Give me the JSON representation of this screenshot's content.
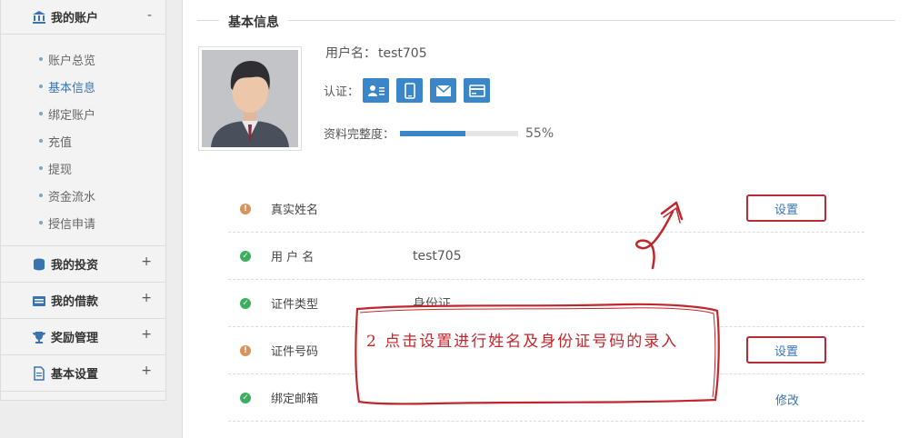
{
  "sidebar": {
    "sections": [
      {
        "label": "我的账户",
        "toggle": "-",
        "icon": "bank-icon"
      },
      {
        "label": "我的投资",
        "toggle": "+",
        "icon": "coins-icon"
      },
      {
        "label": "我的借款",
        "toggle": "+",
        "icon": "card-icon"
      },
      {
        "label": "奖励管理",
        "toggle": "+",
        "icon": "trophy-icon"
      },
      {
        "label": "基本设置",
        "toggle": "+",
        "icon": "document-icon"
      }
    ],
    "account_items": [
      "账户总览",
      "基本信息",
      "绑定账户",
      "充值",
      "提现",
      "资金流水",
      "授信申请"
    ],
    "active_item": "基本信息"
  },
  "main": {
    "section_title": "基本信息",
    "username_label": "用户名：",
    "username_value": "test705",
    "auth_label": "认证：",
    "auth_badges": [
      "id-card-icon",
      "phone-icon",
      "email-icon",
      "bank-card-icon"
    ],
    "completeness_label": "资料完整度：",
    "completeness_value": 55,
    "completeness_text": "55%",
    "rows": [
      {
        "status": "warning",
        "label": "真实姓名",
        "value": "",
        "action": "设置"
      },
      {
        "status": "ok",
        "label": "用 户 名",
        "value": "test705",
        "action": ""
      },
      {
        "status": "ok",
        "label": "证件类型",
        "value": "身份证",
        "action": ""
      },
      {
        "status": "warning",
        "label": "证件号码",
        "value": "",
        "action": "设置"
      },
      {
        "status": "ok",
        "label": "绑定邮箱",
        "value": "",
        "action": "修改"
      }
    ]
  },
  "annotation": {
    "text": "2 点击设置进行姓名及身份证号码的录入",
    "color": "#c0272d"
  },
  "colors": {
    "accent": "#3a86c8",
    "link": "#3a74b0",
    "warning": "#d8935a",
    "ok": "#3cae5f"
  }
}
